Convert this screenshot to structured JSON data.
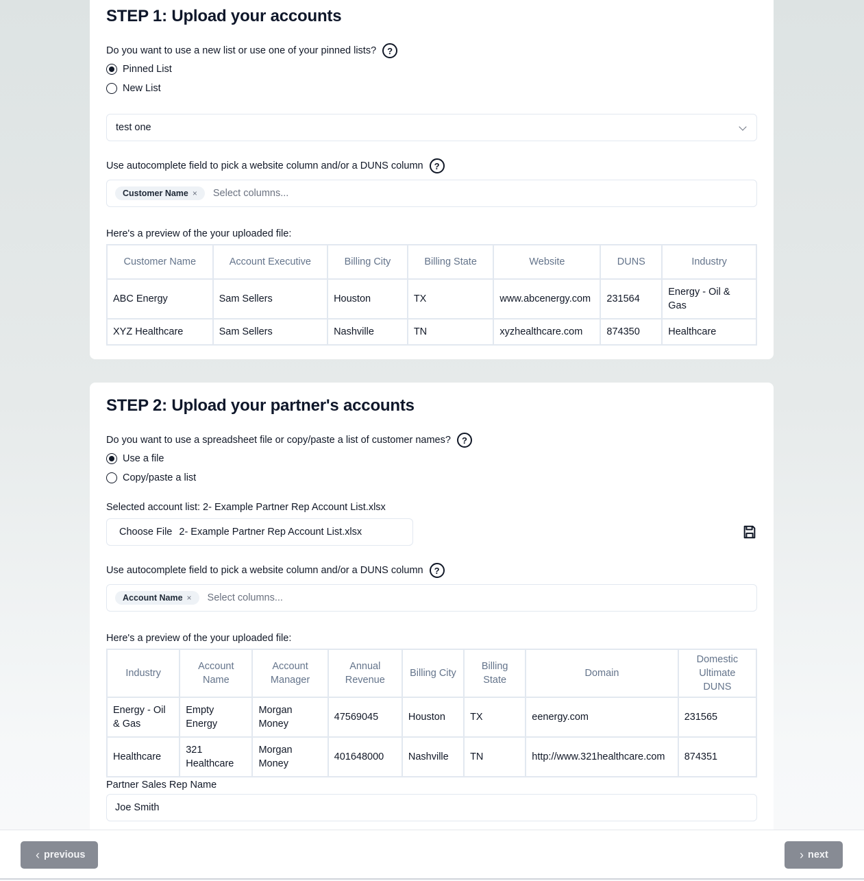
{
  "step1": {
    "title": "STEP 1: Upload your accounts",
    "question": "Do you want to use a new list or use one of your pinned lists?",
    "radios": [
      {
        "label": "Pinned List",
        "checked": true
      },
      {
        "label": "New List",
        "checked": false
      }
    ],
    "pinned_select_value": "test one",
    "autocomplete_label": "Use autocomplete field to pick a website column and/or a DUNS column",
    "tags": [
      {
        "label": "Customer Name",
        "remove": "×"
      }
    ],
    "tags_placeholder": "Select columns...",
    "preview_label": "Here's a preview of the your uploaded file:",
    "table": {
      "headers": [
        "Customer Name",
        "Account Executive",
        "Billing City",
        "Billing State",
        "Website",
        "DUNS",
        "Industry"
      ],
      "rows": [
        [
          "ABC Energy",
          "Sam Sellers",
          "Houston",
          "TX",
          "www.abcenergy.com",
          "231564",
          "Energy - Oil & Gas"
        ],
        [
          "XYZ Healthcare",
          "Sam Sellers",
          "Nashville",
          "TN",
          "xyzhealthcare.com",
          "874350",
          "Healthcare"
        ]
      ]
    }
  },
  "step2": {
    "title": "STEP 2: Upload your partner's accounts",
    "question": "Do you want to use a spreadsheet file or copy/paste a list of customer names?",
    "radios": [
      {
        "label": "Use a file",
        "checked": true
      },
      {
        "label": "Copy/paste a list",
        "checked": false
      }
    ],
    "selected_list_label": "Selected account list: 2- Example Partner Rep Account List.xlsx",
    "choose_file_label": "Choose File",
    "file_name": "2- Example Partner Rep Account List.xlsx",
    "autocomplete_label": "Use autocomplete field to pick a website column and/or a DUNS column",
    "tags": [
      {
        "label": "Account Name",
        "remove": "×"
      }
    ],
    "tags_placeholder": "Select columns...",
    "preview_label": "Here's a preview of the your uploaded file:",
    "table": {
      "headers": [
        "Industry",
        "Account Name",
        "Account Manager",
        "Annual Revenue",
        "Billing City",
        "Billing State",
        "Domain",
        "Domestic Ultimate DUNS"
      ],
      "rows": [
        [
          "Energy - Oil & Gas",
          "Empty Energy",
          "Morgan Money",
          "47569045",
          "Houston",
          "TX",
          "eenergy.com",
          "231565"
        ],
        [
          "Healthcare",
          "321 Healthcare",
          "Morgan Money",
          "401648000",
          "Nashville",
          "TN",
          "http://www.321healthcare.com",
          "874351"
        ]
      ]
    },
    "partner_rep_label": "Partner Sales Rep Name",
    "partner_rep_value": "Joe Smith"
  },
  "footer": {
    "previous_label": "previous",
    "next_label": "next",
    "previous_arrow": "‹",
    "next_arrow": "›"
  }
}
